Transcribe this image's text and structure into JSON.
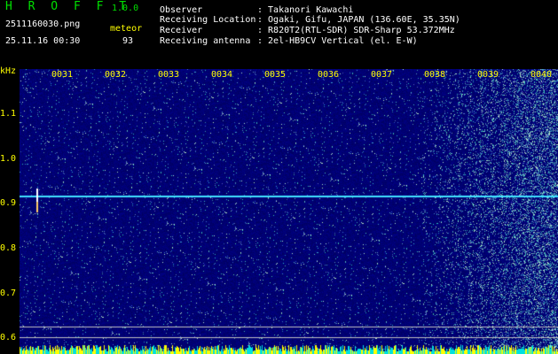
{
  "header": {
    "app_name": "H R O F F T",
    "version": "1.0.0",
    "filename": "2511160030.png",
    "datetime": "25.11.16 00:30",
    "detection_label": "meteor",
    "detection_count": "93",
    "info": [
      {
        "label": "Observer",
        "value": ": Takanori Kawachi"
      },
      {
        "label": "Receiving Location",
        "value": ": Ogaki, Gifu, JAPAN (136.60E, 35.35N)"
      },
      {
        "label": "Receiver",
        "value": ": R820T2(RTL-SDR) SDR-Sharp 53.372MHz"
      },
      {
        "label": "Receiving antenna",
        "value": ": 2el-HB9CV Vertical (el. E-W)"
      }
    ]
  },
  "y_axis": {
    "unit": "kHz",
    "labels": [
      "1.1",
      "1.0",
      "0.9",
      "0.8",
      "0.7",
      "0.6"
    ]
  },
  "time_ticks": [
    "0031",
    "0032",
    "0033",
    "0034",
    "0035",
    "0036",
    "0037",
    "0038",
    "0039",
    "0040"
  ],
  "colors": {
    "text_green": "#00e000",
    "text_yellow": "#ffff00",
    "background": "#000000",
    "signal_cyan": "#40e0ff",
    "baseline_yellow": "#ffff00"
  }
}
